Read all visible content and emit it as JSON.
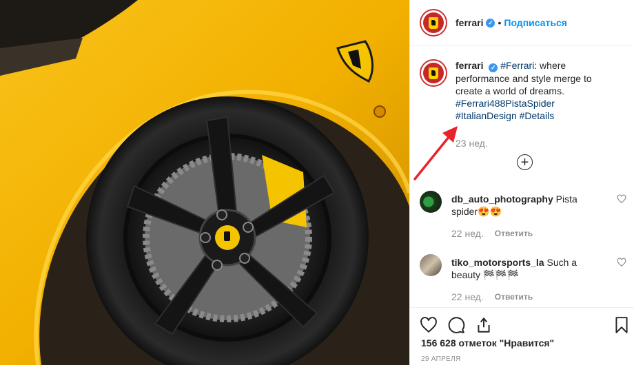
{
  "post": {
    "username": "ferrari",
    "follow_label": "Подписаться",
    "dot": "•",
    "caption_hashtag_1": "#Ferrari",
    "caption_text": ": where performance and style merge to create a world of dreams.",
    "caption_hashtag_2": "#Ferrari488PistaSpider",
    "caption_hashtag_3": "#ItalianDesign",
    "caption_hashtag_4": "#Details",
    "time": "23 нед.",
    "likes": "156 628 отметок \"Нравится\"",
    "date": "29 АПРЕЛЯ"
  },
  "comments": [
    {
      "username": "db_auto_photography",
      "text": " Pista spider😍😍",
      "time": "22 нед.",
      "reply": "Ответить"
    },
    {
      "username": "tiko_motorsports_la",
      "text": " Such a beauty 🏁🏁🏁",
      "time": "22 нед.",
      "reply": "Ответить"
    }
  ],
  "colors": {
    "accent": "#0095f6",
    "hashtag": "#00376b",
    "annotation_arrow": "#e8232a",
    "car_yellow": "#f5b800"
  },
  "icons": [
    "verified-badge",
    "heart-icon",
    "comment-icon",
    "share-icon",
    "bookmark-icon",
    "plus-circle-icon",
    "arrow-annotation"
  ]
}
